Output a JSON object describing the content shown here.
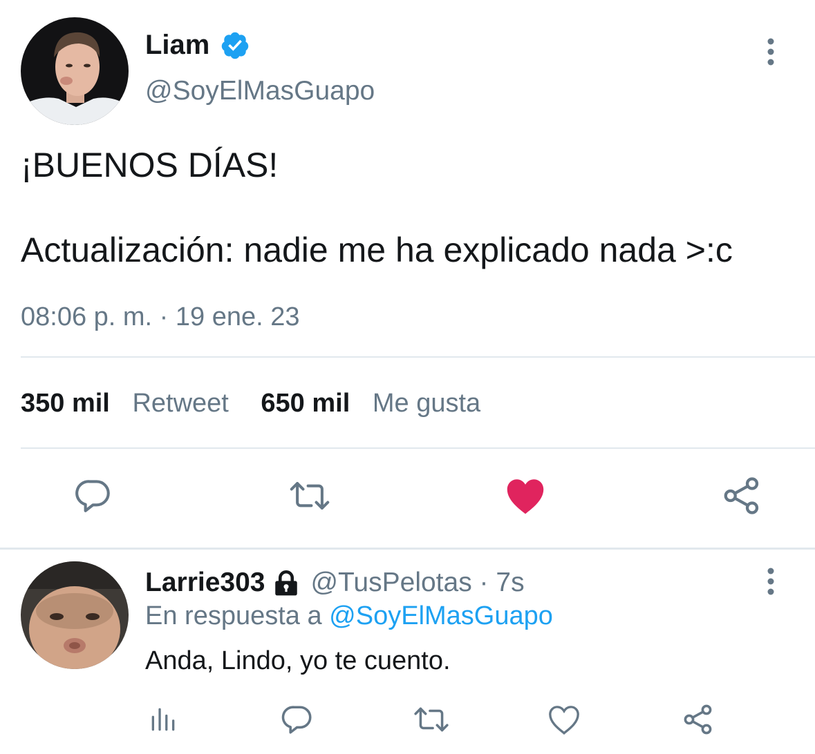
{
  "main_tweet": {
    "author_name": "Liam",
    "author_handle": "@SoyElMasGuapo",
    "verified": true,
    "text_line1": "¡BUENOS DÍAS!",
    "text_line2": "Actualización: nadie me ha explicado nada >:c",
    "timestamp": "08:06 p. m. · 19 ene. 23",
    "retweets_count": "350 mil",
    "retweets_label": "Retweet",
    "likes_count": "650 mil",
    "likes_label": "Me gusta",
    "liked": true,
    "colors": {
      "like_active": "#e0245e",
      "icon": "#657786",
      "verified": "#1da1f2"
    }
  },
  "reply": {
    "author_name": "Larrie303",
    "protected": true,
    "author_handle": "@TusPelotas",
    "time_ago": " · 7s",
    "reply_prefix": "En respuesta a ",
    "reply_to_handle": "@SoyElMasGuapo",
    "text": "Anda, Lindo, yo te cuento.",
    "colors": {
      "link": "#1da1f2"
    }
  }
}
